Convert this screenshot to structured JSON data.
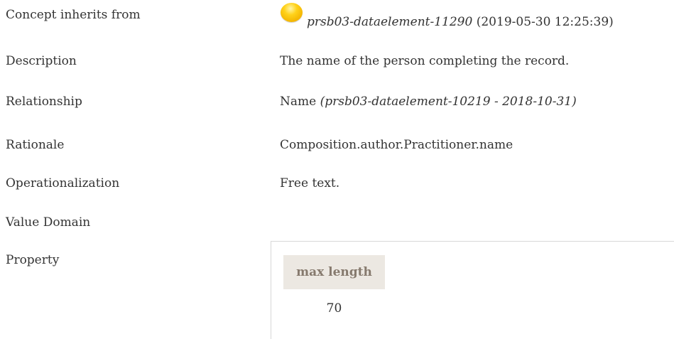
{
  "rows": {
    "inherits": {
      "label": "Concept inherits from",
      "link": "prsb03-dataelement-11290",
      "date": "(2019-05-30 12:25:39)",
      "status_color": "#f5b800"
    },
    "description": {
      "label": "Description",
      "value": "The name of the person completing the record."
    },
    "relationship": {
      "label": "Relationship",
      "value": "Name",
      "ref": "(prsb03-dataelement-10219 - 2018-10-31)"
    },
    "rationale": {
      "label": "Rationale",
      "value": "Composition.author.Practitioner.name"
    },
    "operationalization": {
      "label": "Operationalization",
      "value": "Free text."
    },
    "value_domain": {
      "label": "Value Domain"
    },
    "property": {
      "label": "Property",
      "header": "max length",
      "value": "70"
    }
  }
}
